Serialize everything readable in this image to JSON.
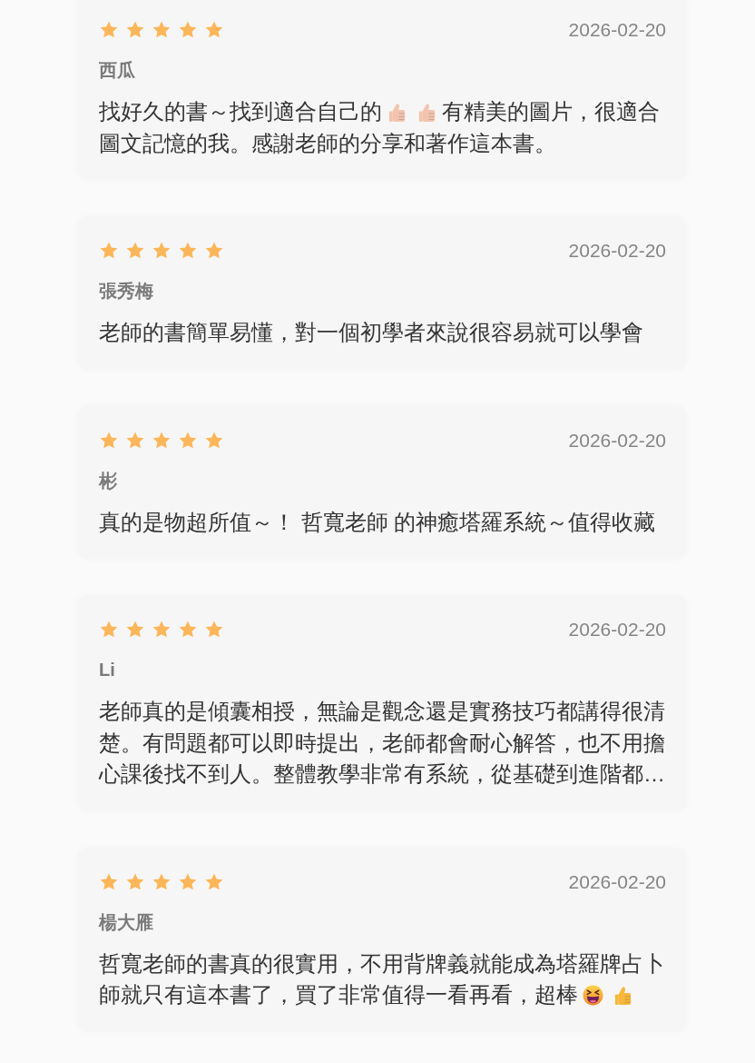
{
  "reviews": [
    {
      "stars": 5,
      "date": "2026-02-20",
      "name": "西瓜",
      "body": [
        {
          "kind": "text",
          "text": "找好久的書～找到適合自己的"
        },
        {
          "kind": "thumbsup",
          "color": "#f2c4ae"
        },
        {
          "kind": "thumbsup",
          "color": "#f2c4ae"
        },
        {
          "kind": "text",
          "text": "有精美的圖片，很適合圖文記憶的我。感謝老師的分享和著作這本書。"
        }
      ]
    },
    {
      "stars": 5,
      "date": "2026-02-20",
      "name": "張秀梅",
      "body": [
        {
          "kind": "text",
          "text": "老師的書簡單易懂，對一個初學者來說很容易就可以學會"
        }
      ]
    },
    {
      "stars": 5,
      "date": "2026-02-20",
      "name": "彬",
      "body": [
        {
          "kind": "text",
          "text": "真的是物超所值～！ 哲寬老師 的神癒塔羅系統～值得收藏"
        }
      ]
    },
    {
      "stars": 5,
      "date": "2026-02-20",
      "name": "Li",
      "body": [
        {
          "kind": "text",
          "text": "老師真的是傾囊相授，無論是觀念還是實務技巧都講得很清楚。有問題都可以即時提出，老師都會耐心解答，也不用擔心課後找不到人。整體教學非常有系統，從基礎到進階都…"
        }
      ]
    },
    {
      "stars": 5,
      "date": "2026-02-20",
      "name": "楊大雁",
      "body": [
        {
          "kind": "text",
          "text": "哲寬老師的書真的很實用，不用背牌義就能成為塔羅牌占卜師就只有這本書了，買了非常值得一看再看，超棒"
        },
        {
          "kind": "laugh"
        },
        {
          "kind": "thumbsup",
          "color": "#f6b73c"
        }
      ]
    }
  ]
}
